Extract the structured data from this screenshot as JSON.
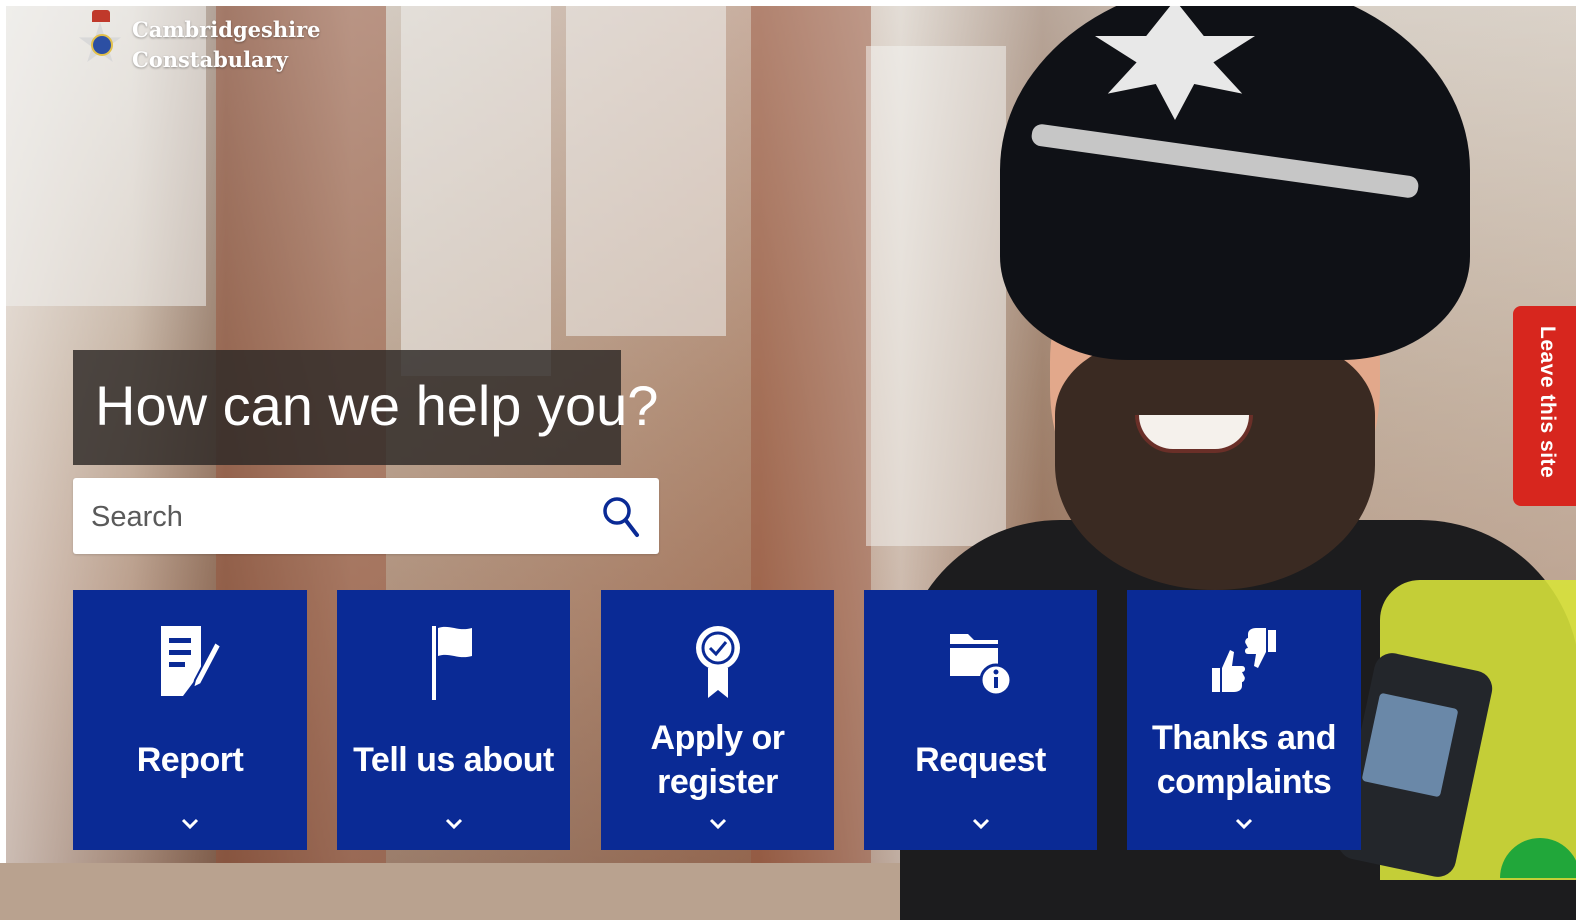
{
  "brand": {
    "line1": "Cambridgeshire",
    "line2": "Constabulary"
  },
  "hero": {
    "headline": "How can we help you?"
  },
  "search": {
    "placeholder": "Search",
    "icon": "search-icon"
  },
  "tiles": [
    {
      "label_line1": "Report",
      "label_line2": "",
      "icon": "document-edit-icon"
    },
    {
      "label_line1": "Tell us about",
      "label_line2": "",
      "icon": "flag-icon"
    },
    {
      "label_line1": "Apply or",
      "label_line2": "register",
      "icon": "badge-rosette-icon"
    },
    {
      "label_line1": "Request",
      "label_line2": "",
      "icon": "folder-info-icon"
    },
    {
      "label_line1": "Thanks and",
      "label_line2": "complaints",
      "icon": "thumbs-up-down-icon"
    }
  ],
  "leave_site": {
    "label": "Leave this site"
  },
  "colors": {
    "tile_blue": "#0a2a95",
    "leave_red": "#d7261e",
    "headline_bg": "#2d2826"
  }
}
